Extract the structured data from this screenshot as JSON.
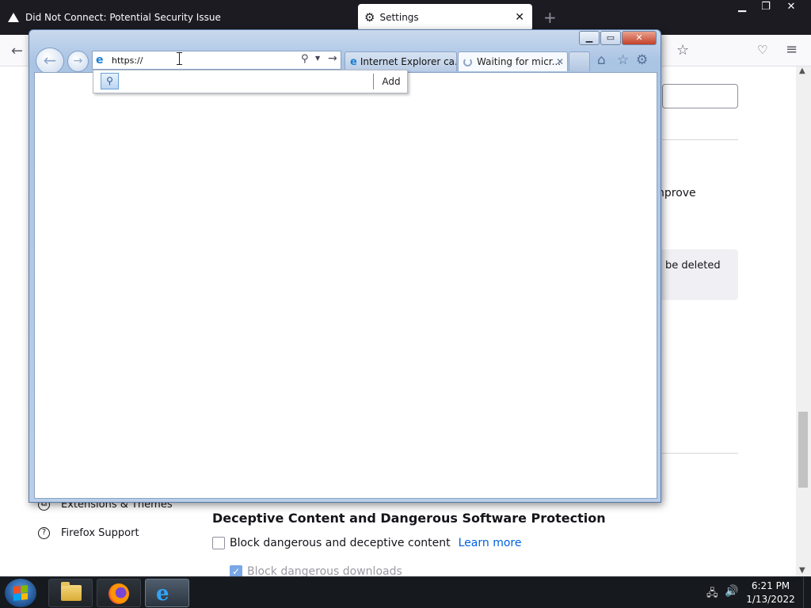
{
  "firefox": {
    "tabs": [
      {
        "label": "Did Not Connect: Potential Security Issue"
      },
      {
        "label": "Settings"
      }
    ],
    "partial_texts": {
      "improve": "nprove",
      "deleted": "be deleted"
    },
    "sidebar": {
      "extensions_label": "Extensions & Themes",
      "support_label": "Firefox Support"
    },
    "security": {
      "section_title": "Deceptive Content and Dangerous Software Protection",
      "block_label": "Block dangerous and deceptive content",
      "learn_more_label": "Learn more",
      "block_downloads_label": "Block dangerous downloads",
      "block_checked": false,
      "downloads_checked": true
    }
  },
  "ie": {
    "address_value": "https://",
    "tabs": [
      {
        "label": "Internet Explorer ca..."
      },
      {
        "label": "Waiting for micr..."
      }
    ],
    "suggest": {
      "add_label": "Add"
    }
  },
  "taskbar": {
    "time": "6:21 PM",
    "date": "1/13/2022"
  },
  "colors": {
    "firefox_tabbar": "#1c1b22",
    "ie_frame": "#aac4e4",
    "taskbar": "#16191d",
    "link": "#0061e0"
  }
}
